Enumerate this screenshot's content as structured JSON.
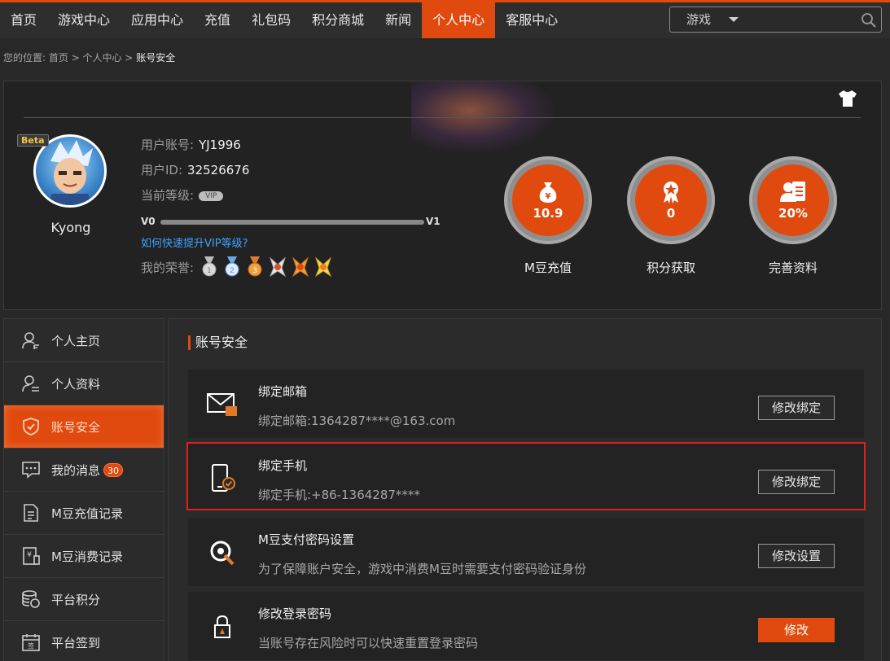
{
  "nav": {
    "items": [
      {
        "label": "首页",
        "active": false
      },
      {
        "label": "游戏中心",
        "active": false
      },
      {
        "label": "应用中心",
        "active": false
      },
      {
        "label": "充值",
        "active": false
      },
      {
        "label": "礼包码",
        "active": false
      },
      {
        "label": "积分商城",
        "active": false
      },
      {
        "label": "新闻",
        "active": false
      },
      {
        "label": "个人中心",
        "active": true
      },
      {
        "label": "客服中心",
        "active": false
      }
    ],
    "search": {
      "category": "游戏",
      "placeholder": ""
    }
  },
  "breadcrumb": {
    "prefix": "您的位置:",
    "path": "首页 > 个人中心 > ",
    "current": "账号安全"
  },
  "profile": {
    "beta": "Beta",
    "name": "Kyong",
    "account_label": "用户账号:",
    "account_value": "YJ1996",
    "id_label": "用户ID:",
    "id_value": "32526676",
    "level_label": "当前等级:",
    "vip_badge": "VIP",
    "level_left": "V0",
    "level_right": "V1",
    "progress": 0,
    "vip_link": "如何快速提升VIP等级?",
    "honor_label": "我的荣誉:",
    "stats": [
      {
        "value": "10.9",
        "label": "M豆充值",
        "icon": "money-bag-icon"
      },
      {
        "value": "0",
        "label": "积分获取",
        "icon": "award-ribbon-icon"
      },
      {
        "value": "20%",
        "label": "完善资料",
        "icon": "profile-card-icon"
      }
    ]
  },
  "sidebar": {
    "items": [
      {
        "label": "个人主页",
        "icon": "user-home-icon"
      },
      {
        "label": "个人资料",
        "icon": "user-profile-icon"
      },
      {
        "label": "账号安全",
        "icon": "shield-icon",
        "active": true
      },
      {
        "label": "我的消息",
        "icon": "message-icon",
        "badge": "30"
      },
      {
        "label": "M豆充值记录",
        "icon": "recharge-record-icon"
      },
      {
        "label": "M豆消费记录",
        "icon": "spend-record-icon"
      },
      {
        "label": "平台积分",
        "icon": "coins-icon"
      },
      {
        "label": "平台签到",
        "icon": "signin-calendar-icon"
      }
    ]
  },
  "main": {
    "title": "账号安全",
    "items": [
      {
        "title": "绑定邮箱",
        "desc": "绑定邮箱:1364287****@163.com",
        "button": "修改绑定",
        "icon": "email-icon"
      },
      {
        "title": "绑定手机",
        "desc": "绑定手机:+86-1364287****",
        "button": "修改绑定",
        "icon": "phone-icon",
        "highlight": true
      },
      {
        "title": "M豆支付密码设置",
        "desc": "为了保障账户安全，游戏中消费M豆时需要支付密码验证身份",
        "button": "修改设置",
        "icon": "pay-password-icon"
      },
      {
        "title": "修改登录密码",
        "desc": "当账号存在风险时可以快速重置登录密码",
        "button": "修改",
        "icon": "lock-icon",
        "primary": true
      }
    ]
  },
  "colors": {
    "accent": "#e04a0e",
    "highlight_border": "#e0201a"
  }
}
